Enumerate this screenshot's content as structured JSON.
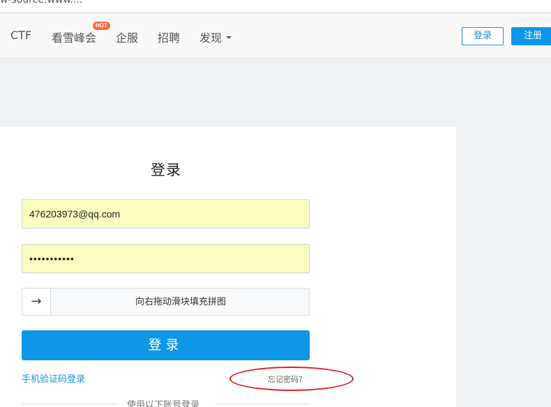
{
  "top_strip": {
    "text": "w-source.www...."
  },
  "navbar": {
    "items": [
      {
        "label": "CTF"
      },
      {
        "label": "看雪峰会",
        "badge": "HOT"
      },
      {
        "label": "企服"
      },
      {
        "label": "招聘"
      },
      {
        "label": "发现"
      }
    ],
    "login_label": "登录",
    "register_label": "注册"
  },
  "login_form": {
    "title": "登录",
    "email_value": "476203973@qq.com",
    "password_mask": "•••••••••••",
    "slider_text": "向右拖动滑块填充拼图",
    "slider_handle_glyph": "→",
    "submit_label": "登录",
    "phone_login_link": "手机验证码登录",
    "forgot_password_link": "忘记密码?",
    "divider_text": "使用以下账号登录"
  },
  "colors": {
    "accent": "#0d97e6",
    "autofill_bg": "#fafcc0",
    "annotation_red": "#e21a1a",
    "hot_badge": "#ff6a3d"
  }
}
